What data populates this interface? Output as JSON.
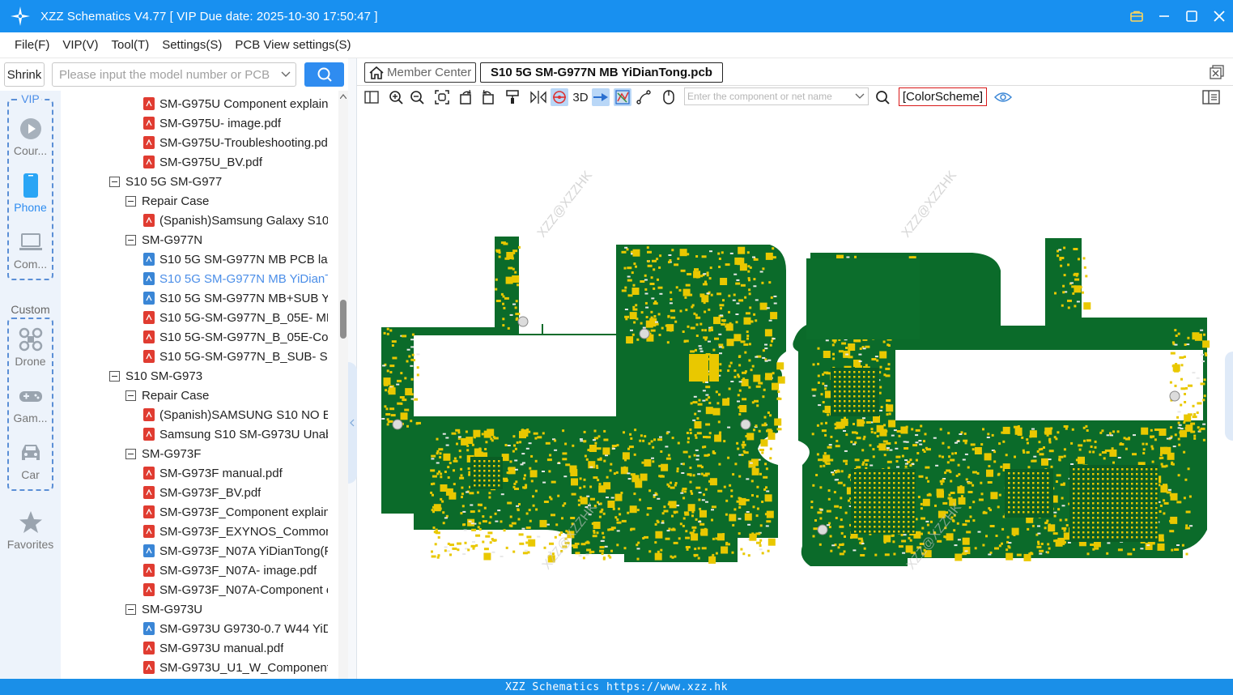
{
  "app": {
    "title": "XZZ Schematics V4.77 [ VIP Due date: 2025-10-30 17:50:47 ]"
  },
  "menu": [
    {
      "label": "File(F)"
    },
    {
      "label": "VIP(V)"
    },
    {
      "label": "Tool(T)"
    },
    {
      "label": "Settings(S)"
    },
    {
      "label": "PCB View settings(S)"
    }
  ],
  "search": {
    "shrink_label": "Shrink",
    "placeholder": "Please input the model number or PCB"
  },
  "rail": {
    "vip_label": "VIP",
    "custom_label": "Custom",
    "items": [
      {
        "label": "Cour...",
        "icon": "play-icon"
      },
      {
        "label": "Phone",
        "icon": "phone-icon"
      },
      {
        "label": "Com...",
        "icon": "laptop-icon"
      },
      {
        "label": "Drone",
        "icon": "drone-icon"
      },
      {
        "label": "Gam...",
        "icon": "gamepad-icon"
      },
      {
        "label": "Car",
        "icon": "car-icon"
      },
      {
        "label": "Favorites",
        "icon": "star-icon"
      }
    ]
  },
  "tree": [
    {
      "label": "SM-G975U Component explain.",
      "type": "pdf",
      "level": 3
    },
    {
      "label": "SM-G975U- image.pdf",
      "type": "pdf",
      "level": 3
    },
    {
      "label": "SM-G975U-Troubleshooting.pd",
      "type": "pdf",
      "level": 3
    },
    {
      "label": "SM-G975U_BV.pdf",
      "type": "pdf",
      "level": 3
    },
    {
      "label": "S10 5G SM-G977",
      "type": "folder",
      "level": 1
    },
    {
      "label": "Repair Case",
      "type": "folder",
      "level": 2
    },
    {
      "label": "(Spanish)Samsung Galaxy S10 5",
      "type": "pdf",
      "level": 3
    },
    {
      "label": "SM-G977N",
      "type": "folder",
      "level": 2
    },
    {
      "label": "S10 5G SM-G977N MB PCB laye",
      "type": "pcb",
      "level": 3
    },
    {
      "label": "S10 5G SM-G977N MB YiDianTc",
      "type": "pcb",
      "level": 3,
      "selected": true
    },
    {
      "label": "S10 5G SM-G977N MB+SUB YiD",
      "type": "pcb",
      "level": 3
    },
    {
      "label": "S10 5G-SM-G977N_B_05E- MB i",
      "type": "pdf",
      "level": 3
    },
    {
      "label": "S10 5G-SM-G977N_B_05E-Comp",
      "type": "pdf",
      "level": 3
    },
    {
      "label": "S10 5G-SM-G977N_B_SUB- SUB",
      "type": "pdf",
      "level": 3
    },
    {
      "label": "S10 SM-G973",
      "type": "folder",
      "level": 1
    },
    {
      "label": "Repair Case",
      "type": "folder",
      "level": 2
    },
    {
      "label": "(Spanish)SAMSUNG S10 NO EN",
      "type": "pdf",
      "level": 3
    },
    {
      "label": "Samsung S10 SM-G973U  Unab",
      "type": "pdf",
      "level": 3
    },
    {
      "label": "SM-G973F",
      "type": "folder",
      "level": 2
    },
    {
      "label": "SM-G973F manual.pdf",
      "type": "pdf",
      "level": 3
    },
    {
      "label": "SM-G973F_BV.pdf",
      "type": "pdf",
      "level": 3
    },
    {
      "label": "SM-G973F_Component explain.",
      "type": "pdf",
      "level": 3
    },
    {
      "label": "SM-G973F_EXYNOS_Common_S",
      "type": "pdf",
      "level": 3
    },
    {
      "label": "SM-G973F_N07A YiDianTong(Fc",
      "type": "pcb",
      "level": 3
    },
    {
      "label": "SM-G973F_N07A- image.pdf",
      "type": "pdf",
      "level": 3
    },
    {
      "label": "SM-G973F_N07A-Component e",
      "type": "pdf",
      "level": 3
    },
    {
      "label": "SM-G973U",
      "type": "folder",
      "level": 2
    },
    {
      "label": "SM-G973U G9730-0.7 W44 YiDia",
      "type": "pcb",
      "level": 3
    },
    {
      "label": "SM-G973U manual.pdf",
      "type": "pdf",
      "level": 3
    },
    {
      "label": "SM-G973U_U1_W_Component",
      "type": "pdf",
      "level": 3
    }
  ],
  "tabs": {
    "member_center": "Member Center",
    "active_file": "S10 5G SM-G977N MB YiDianTong.pcb"
  },
  "toolbar": {
    "label_3d": "3D",
    "component_placeholder": "Enter the component or net name",
    "colorscheme": "[ColorScheme]"
  },
  "canvas": {
    "watermark": "XZZ@XZZHK",
    "board_color": "#0b6b2a",
    "pad_color": "#e9c800"
  },
  "footer": {
    "text": "XZZ Schematics https://www.xzz.hk"
  }
}
